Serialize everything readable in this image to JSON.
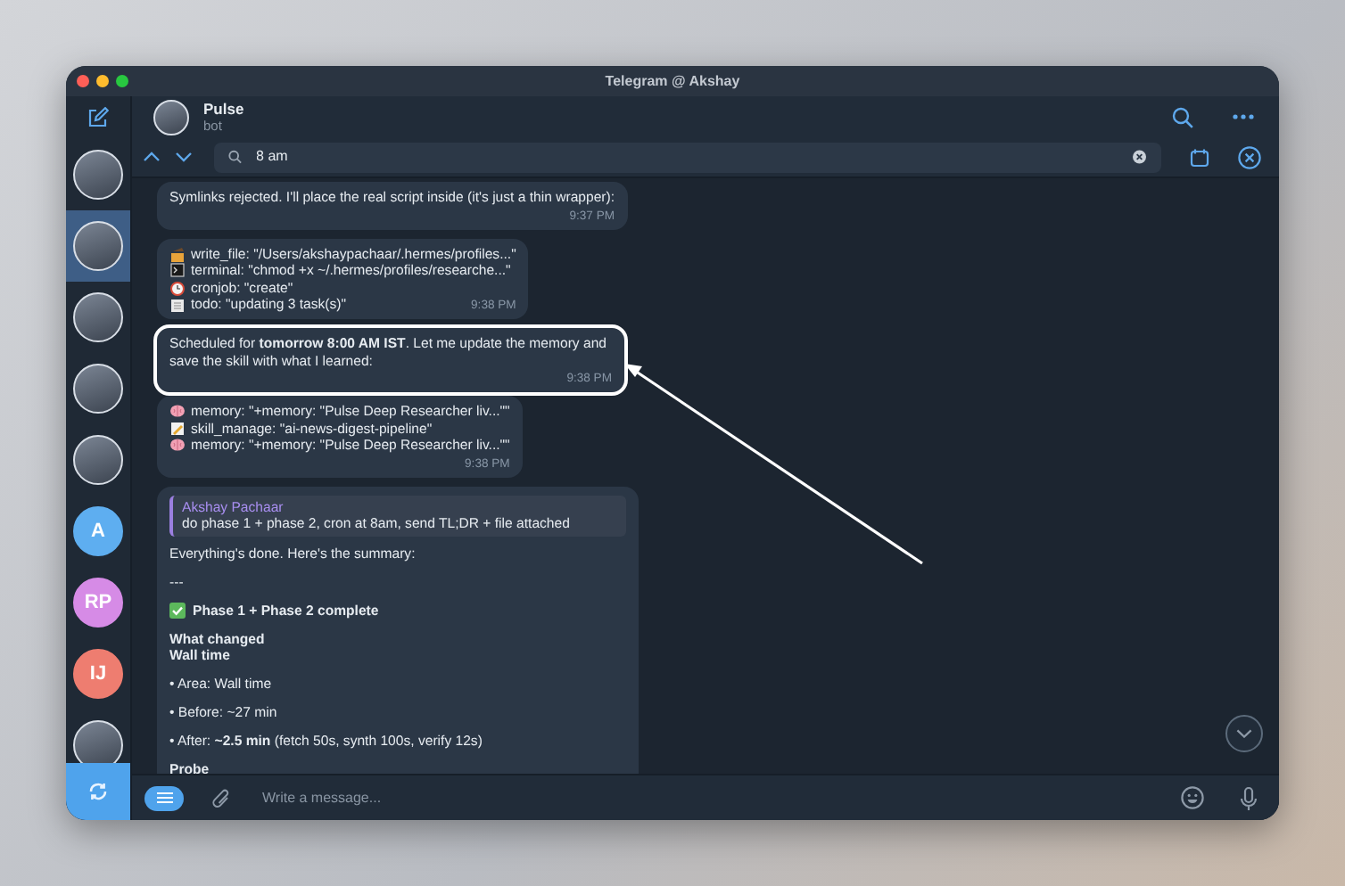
{
  "window": {
    "title": "Telegram @ Akshay"
  },
  "sidebar": {
    "chats": [
      {
        "kind": "photo",
        "selected": false
      },
      {
        "kind": "photo",
        "selected": true
      },
      {
        "kind": "photo",
        "selected": false
      },
      {
        "kind": "photo",
        "selected": false
      },
      {
        "kind": "photo",
        "selected": false
      },
      {
        "kind": "initials",
        "initials": "A",
        "color": "#5eaef0",
        "selected": false
      },
      {
        "kind": "initials",
        "initials": "RP",
        "color": "#d68be6",
        "selected": false
      },
      {
        "kind": "initials",
        "initials": "IJ",
        "color": "#ee7d70",
        "selected": false
      },
      {
        "kind": "photo",
        "selected": false
      }
    ]
  },
  "chat": {
    "name": "Pulse",
    "subtitle": "bot"
  },
  "search": {
    "value": "8 am"
  },
  "messages": [
    {
      "kind": "text",
      "text": "Symlinks rejected. I'll place the real script inside (it's just a thin wrapper):",
      "time": "9:37 PM",
      "highlighted": false
    },
    {
      "kind": "tools",
      "lines": [
        {
          "kind": "write",
          "text": "write_file: \"/Users/akshaypachaar/.hermes/profiles...\""
        },
        {
          "kind": "terminal",
          "text": "terminal: \"chmod +x ~/.hermes/profiles/researche...\""
        },
        {
          "kind": "alarm",
          "text": "cronjob: \"create\""
        },
        {
          "kind": "todo",
          "text": "todo: \"updating 3 task(s)\""
        }
      ],
      "time": "9:38 PM",
      "highlighted": false
    },
    {
      "kind": "text",
      "text": "Scheduled for **tomorrow 8:00 AM IST**. Let me update the memory and save the skill with what I learned:",
      "time": "9:38 PM",
      "highlighted": true
    },
    {
      "kind": "tools",
      "lines": [
        {
          "kind": "memory",
          "text": "memory: \"+memory: \"Pulse Deep Researcher liv...\"\""
        },
        {
          "kind": "skill",
          "text": "skill_manage: \"ai-news-digest-pipeline\""
        },
        {
          "kind": "memory",
          "text": "memory: \"+memory: \"Pulse Deep Researcher liv...\"\""
        }
      ],
      "time": "9:38 PM",
      "highlighted": false
    },
    {
      "kind": "reply",
      "quote": {
        "author": "Akshay Pachaar",
        "text": "do phase 1 + phase 2, cron at 8am, send TL;DR + file attached"
      },
      "body": [
        {
          "kind": "para",
          "text": "Everything's done. Here's the summary:"
        },
        {
          "kind": "para",
          "text": "---"
        },
        {
          "kind": "check",
          "text": "Phase 1 + Phase 2 complete"
        },
        {
          "kind": "heading",
          "text": "What changed"
        },
        {
          "kind": "heading",
          "text": "Wall time",
          "tight": true
        },
        {
          "kind": "para",
          "text": "• Area: Wall time"
        },
        {
          "kind": "para",
          "text": "• Before: ~27 min"
        },
        {
          "kind": "para",
          "text": "• After: **~2.5 min** (fetch 50s, synth 100s, verify 12s)"
        },
        {
          "kind": "heading",
          "text": "Probe"
        }
      ],
      "highlighted": false
    }
  ],
  "composer": {
    "placeholder": "Write a message..."
  }
}
